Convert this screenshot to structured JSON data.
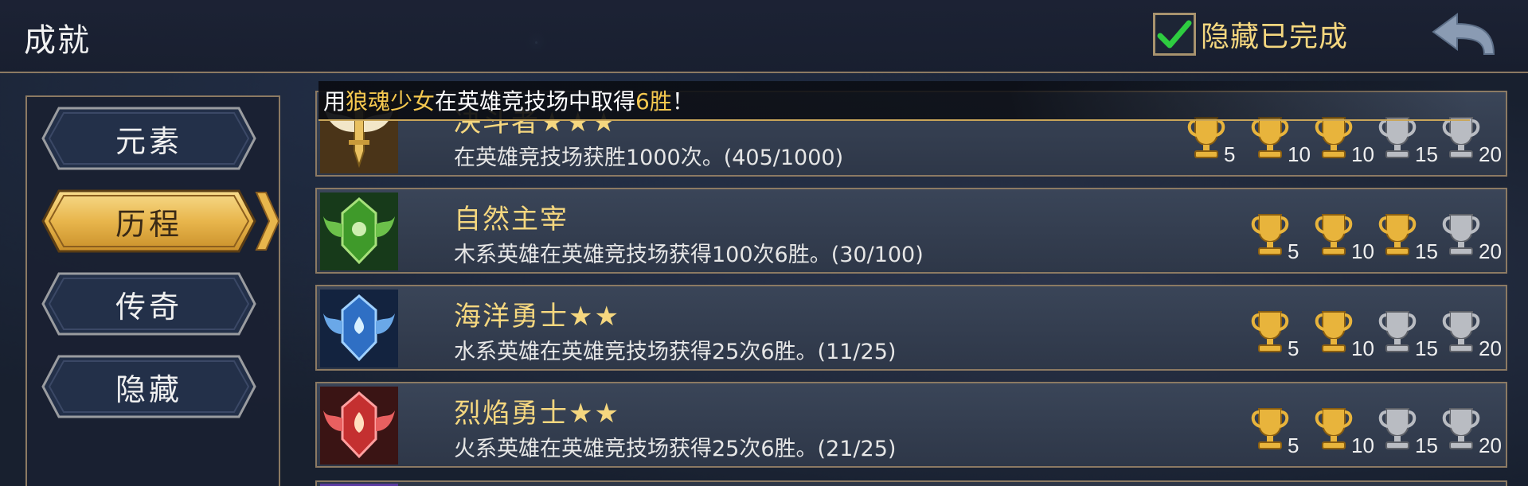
{
  "header": {
    "title": "成就",
    "hide_completed_label": "隐藏已完成",
    "hide_completed_checked": true
  },
  "sidebar": {
    "items": [
      {
        "label": "元素",
        "active": false
      },
      {
        "label": "历程",
        "active": true
      },
      {
        "label": "传奇",
        "active": false
      },
      {
        "label": "隐藏",
        "active": false
      }
    ]
  },
  "toast": {
    "prefix": "用 ",
    "hero": "狼魂少女",
    "middle": " 在英雄竞技场中取得 ",
    "count": "6胜",
    "suffix": "！"
  },
  "achievements": [
    {
      "title": "决斗者★★★",
      "desc": "在英雄竞技场获胜1000次。(405/1000)",
      "badge_color": "#c99a3a",
      "badge_icon": "sword-wings-icon",
      "rewards": [
        {
          "value": "5",
          "earned": true
        },
        {
          "value": "10",
          "earned": true
        },
        {
          "value": "10",
          "earned": true
        },
        {
          "value": "15",
          "earned": false
        },
        {
          "value": "20",
          "earned": false
        }
      ]
    },
    {
      "title": "自然主宰",
      "desc": "木系英雄在英雄竞技场获得100次6胜。(30/100)",
      "badge_color": "#3f9a2a",
      "badge_icon": "nature-crest-icon",
      "rewards": [
        {
          "value": "5",
          "earned": true
        },
        {
          "value": "10",
          "earned": true
        },
        {
          "value": "15",
          "earned": true
        },
        {
          "value": "20",
          "earned": false
        }
      ]
    },
    {
      "title": "海洋勇士★★",
      "desc": "水系英雄在英雄竞技场获得25次6胜。(11/25)",
      "badge_color": "#2f6fc4",
      "badge_icon": "water-crest-icon",
      "rewards": [
        {
          "value": "5",
          "earned": true
        },
        {
          "value": "10",
          "earned": true
        },
        {
          "value": "15",
          "earned": false
        },
        {
          "value": "20",
          "earned": false
        }
      ]
    },
    {
      "title": "烈焰勇士★★",
      "desc": "火系英雄在英雄竞技场获得25次6胜。(21/25)",
      "badge_color": "#c43030",
      "badge_icon": "fire-crest-icon",
      "rewards": [
        {
          "value": "5",
          "earned": true
        },
        {
          "value": "10",
          "earned": true
        },
        {
          "value": "15",
          "earned": false
        },
        {
          "value": "20",
          "earned": false
        }
      ]
    }
  ],
  "colors": {
    "gold_text": "#f5d77f",
    "trophy_gold": "#e8b43c",
    "trophy_silver": "#b9bcc2",
    "panel_border": "#8c7a63",
    "check_green": "#2ecc40"
  }
}
